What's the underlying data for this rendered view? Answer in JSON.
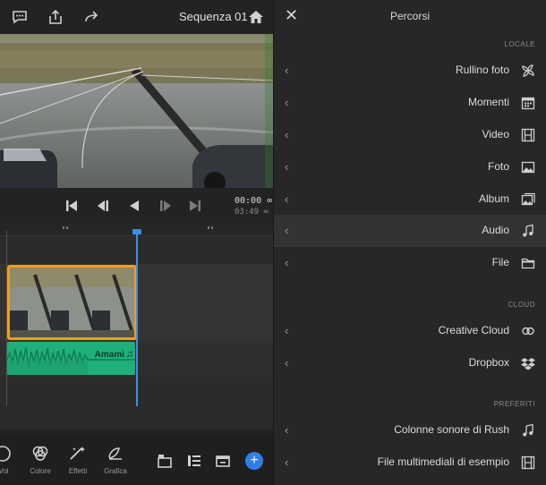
{
  "editor": {
    "sequence_title": "Sequenza 01",
    "timecode_current": "00:00 ∞",
    "timecode_total": "03:49 ∞",
    "audio_clip_label": "Amami",
    "bottom_tools": [
      {
        "icon": "graphics-icon",
        "label": "Grafica"
      },
      {
        "icon": "effects-icon",
        "label": "Effetti"
      },
      {
        "icon": "color-icon",
        "label": "Colore"
      },
      {
        "icon": "volume-icon",
        "label": "Vol"
      }
    ],
    "add_symbol": "+"
  },
  "panel": {
    "title": "Percorsi",
    "close_symbol": "✕",
    "chevron": "‹",
    "sections": {
      "local": "LOCALE",
      "cloud": "CLOUD",
      "favorites": "PREFERITI"
    },
    "local_items": [
      {
        "label": "Rullino foto",
        "icon": "camera-roll-icon"
      },
      {
        "label": "Momenti",
        "icon": "calendar-icon"
      },
      {
        "label": "Video",
        "icon": "film-icon"
      },
      {
        "label": "Foto",
        "icon": "photo-icon"
      },
      {
        "label": "Album",
        "icon": "album-icon"
      },
      {
        "label": "Audio",
        "icon": "music-note-icon",
        "selected": true
      },
      {
        "label": "File",
        "icon": "folder-icon"
      }
    ],
    "cloud_items": [
      {
        "label": "Creative Cloud",
        "icon": "creative-cloud-icon"
      },
      {
        "label": "Dropbox",
        "icon": "dropbox-icon"
      }
    ],
    "favorite_items": [
      {
        "label": "Colonne sonore di Rush",
        "icon": "music-note-icon"
      },
      {
        "label": "File multimediali di esempio",
        "icon": "film-icon"
      }
    ]
  },
  "colors": {
    "accent_blue": "#2f7ee6",
    "clip_orange": "#f39c1c",
    "audio_green": "#1fb07a"
  }
}
